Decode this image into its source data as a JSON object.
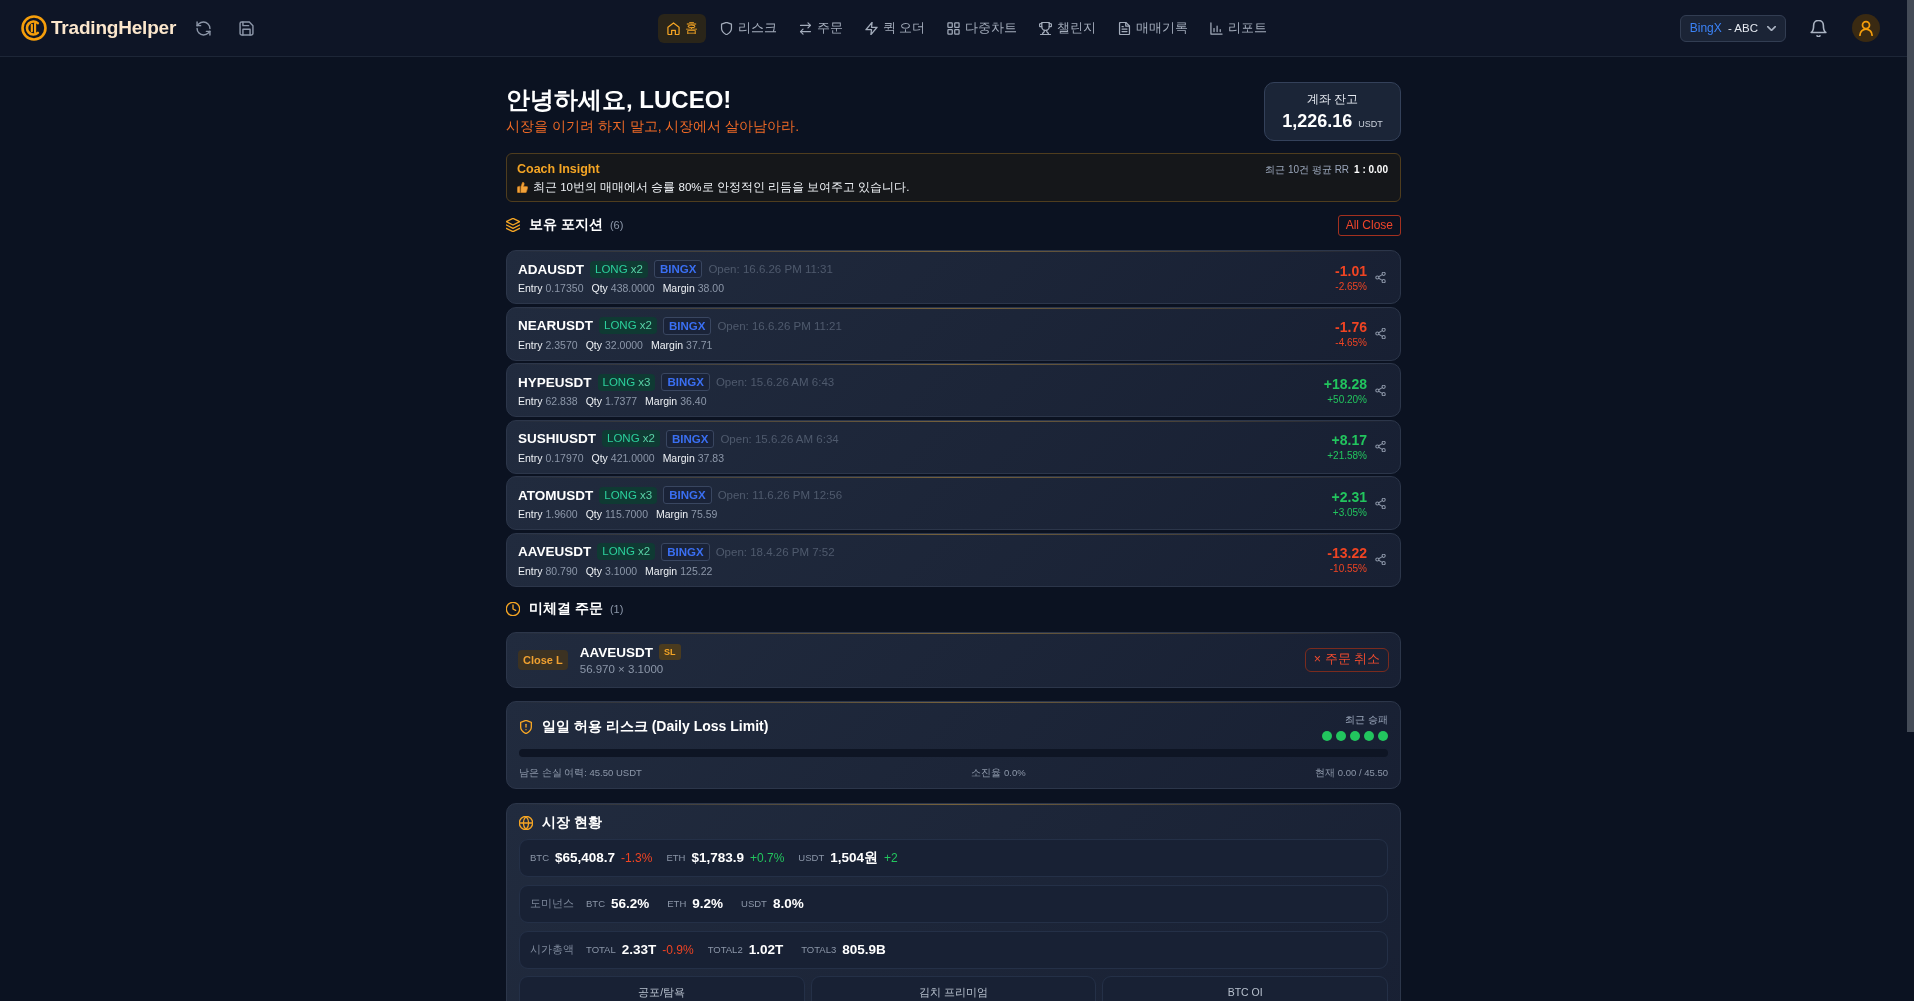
{
  "header": {
    "app_name": "TradingHelper",
    "nav": [
      {
        "label": "홈",
        "selected": true
      },
      {
        "label": "리스크",
        "selected": false
      },
      {
        "label": "주문",
        "selected": false
      },
      {
        "label": "퀵 오더",
        "selected": false
      },
      {
        "label": "다중차트",
        "selected": false
      },
      {
        "label": "챌린지",
        "selected": false
      },
      {
        "label": "매매기록",
        "selected": false
      },
      {
        "label": "리포트",
        "selected": false
      }
    ],
    "account_selector": {
      "exchange": "BingX",
      "separator": "-",
      "account": "ABC"
    }
  },
  "greeting": {
    "title": "안녕하세요, LUCEO!",
    "subtitle": "시장을 이기려 하지 말고, 시장에서 살아남아라."
  },
  "balance": {
    "label": "계좌 잔고",
    "value": "1,226.16",
    "unit": "USDT"
  },
  "coach_insight": {
    "title": "Coach Insight",
    "message": "최근 10번의 매매에서 승률 80%로 안정적인 리듬을 보여주고 있습니다.",
    "rr_label": "최근 10건 평균 RR",
    "rr_value": "1 : 0.00"
  },
  "positions": {
    "title": "보유 포지션",
    "count": "(6)",
    "close_all": "All Close",
    "items": [
      {
        "symbol": "ADAUSDT",
        "side": "LONG",
        "leverage": "x2",
        "exchange": "BINGX",
        "opened": "Open: 16.6.26 PM 11:31",
        "details": [
          {
            "label": "Entry",
            "value": "0.17350"
          },
          {
            "label": "Qty",
            "value": "438.0000"
          },
          {
            "label": "Margin",
            "value": "38.00"
          }
        ],
        "pnl": "-1.01",
        "pnl_percent": "-2.65%",
        "color": "#ef4423"
      },
      {
        "symbol": "NEARUSDT",
        "side": "LONG",
        "leverage": "x2",
        "exchange": "BINGX",
        "opened": "Open: 16.6.26 PM 11:21",
        "details": [
          {
            "label": "Entry",
            "value": "2.3570"
          },
          {
            "label": "Qty",
            "value": "32.0000"
          },
          {
            "label": "Margin",
            "value": "37.71"
          }
        ],
        "pnl": "-1.76",
        "pnl_percent": "-4.65%",
        "color": "#ef4423"
      },
      {
        "symbol": "HYPEUSDT",
        "side": "LONG",
        "leverage": "x3",
        "exchange": "BINGX",
        "opened": "Open: 15.6.26 AM 6:43",
        "details": [
          {
            "label": "Entry",
            "value": "62.838"
          },
          {
            "label": "Qty",
            "value": "1.7377"
          },
          {
            "label": "Margin",
            "value": "36.40"
          }
        ],
        "pnl": "+18.28",
        "pnl_percent": "+50.20%",
        "color": "#22c55e"
      },
      {
        "symbol": "SUSHIUSDT",
        "side": "LONG",
        "leverage": "x2",
        "exchange": "BINGX",
        "opened": "Open: 15.6.26 AM 6:34",
        "details": [
          {
            "label": "Entry",
            "value": "0.17970"
          },
          {
            "label": "Qty",
            "value": "421.0000"
          },
          {
            "label": "Margin",
            "value": "37.83"
          }
        ],
        "pnl": "+8.17",
        "pnl_percent": "+21.58%",
        "color": "#22c55e"
      },
      {
        "symbol": "ATOMUSDT",
        "side": "LONG",
        "leverage": "x3",
        "exchange": "BINGX",
        "opened": "Open: 11.6.26 PM 12:56",
        "details": [
          {
            "label": "Entry",
            "value": "1.9600"
          },
          {
            "label": "Qty",
            "value": "115.7000"
          },
          {
            "label": "Margin",
            "value": "75.59"
          }
        ],
        "pnl": "+2.31",
        "pnl_percent": "+3.05%",
        "color": "#22c55e"
      },
      {
        "symbol": "AAVEUSDT",
        "side": "LONG",
        "leverage": "x2",
        "exchange": "BINGX",
        "opened": "Open: 18.4.26 PM 7:52",
        "details": [
          {
            "label": "Entry",
            "value": "80.790"
          },
          {
            "label": "Qty",
            "value": "3.1000"
          },
          {
            "label": "Margin",
            "value": "125.22"
          }
        ],
        "pnl": "-13.22",
        "pnl_percent": "-10.55%",
        "color": "#ef4423"
      }
    ]
  },
  "pending_orders": {
    "title": "미체결 주문",
    "count": "(1)",
    "orders": [
      {
        "type": "Close L",
        "symbol": "AAVEUSDT",
        "tag": "SL",
        "detail": "56.970 × 3.1000",
        "cancel_label": "× 주문 취소"
      }
    ]
  },
  "daily_risk": {
    "title": "일일 허용 리스크 (Daily Loss Limit)",
    "recent_label": "최근 승패",
    "recent": [
      {
        "color": "#22c55e"
      },
      {
        "color": "#22c55e"
      },
      {
        "color": "#22c55e"
      },
      {
        "color": "#22c55e"
      },
      {
        "color": "#22c55e"
      }
    ],
    "level": 0,
    "remaining": "남은 손실 여력: 45.50 USDT",
    "usage": "소진율 0.0%",
    "current": "현재 0.00 / 45.50"
  },
  "market": {
    "title": "시장 현황",
    "rows": [
      {
        "items": [
          {
            "symbol": "BTC",
            "value": "$65,408.7",
            "change": "-1.3%",
            "color": "#ef4423"
          },
          {
            "symbol": "ETH",
            "value": "$1,783.9",
            "change": "+0.7%",
            "color": "#22c55e"
          },
          {
            "symbol": "USDT",
            "value": "1,504원",
            "change": "+2",
            "color": "#22c55e"
          }
        ]
      },
      {
        "label": "도미넌스",
        "items": [
          {
            "symbol": "BTC",
            "value": "56.2%"
          },
          {
            "symbol": "ETH",
            "value": "9.2%"
          },
          {
            "symbol": "USDT",
            "value": "8.0%"
          }
        ]
      },
      {
        "label": "시가총액",
        "items": [
          {
            "symbol": "TOTAL",
            "value": "2.33T",
            "change": "-0.9%",
            "color": "#ef4423"
          },
          {
            "symbol": "TOTAL2",
            "value": "1.02T"
          },
          {
            "symbol": "TOTAL3",
            "value": "805.9B"
          }
        ]
      }
    ],
    "tiles": [
      {
        "title": "공포/탐욕"
      },
      {
        "title": "김치 프리미엄"
      },
      {
        "title": "BTC OI"
      }
    ]
  }
}
